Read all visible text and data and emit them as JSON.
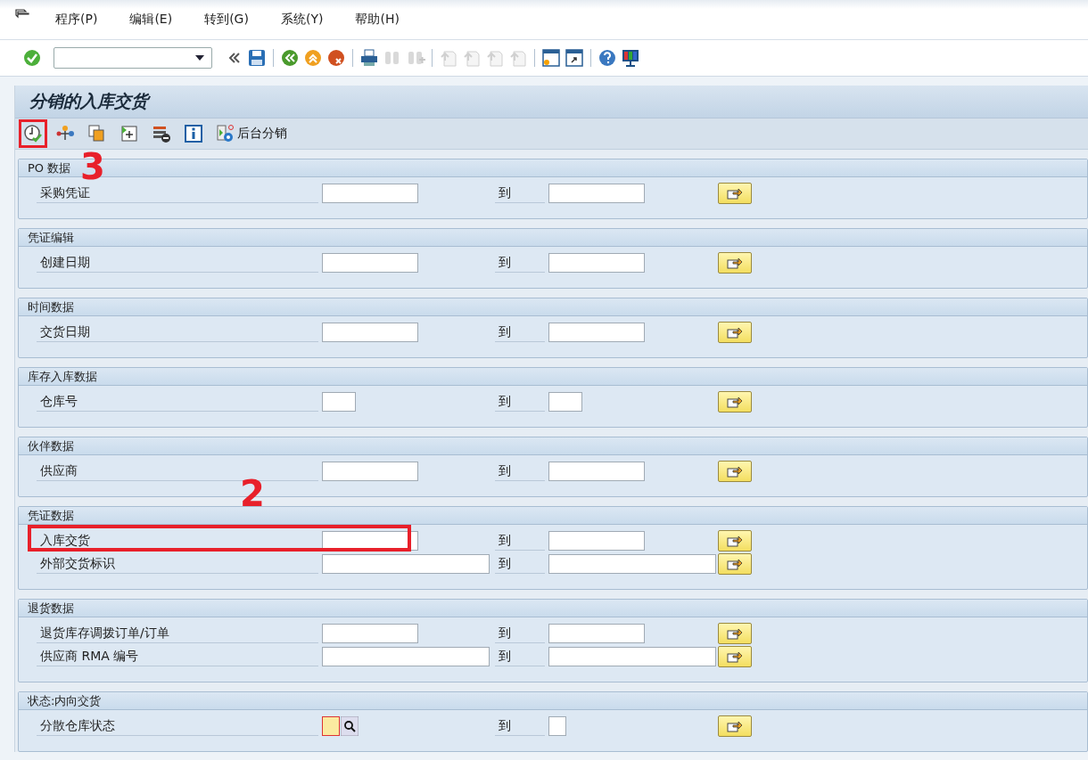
{
  "menu": [
    {
      "label": "程序(P)"
    },
    {
      "label": "编辑(E)"
    },
    {
      "label": "转到(G)"
    },
    {
      "label": "系统(Y)"
    },
    {
      "label": "帮助(H)"
    }
  ],
  "toolbar": [
    {
      "kind": "enter",
      "disabled": false
    },
    {
      "kind": "command"
    },
    {
      "kind": "collapse",
      "disabled": false
    },
    {
      "kind": "save",
      "disabled": false
    },
    {
      "kind": "sep"
    },
    {
      "kind": "back",
      "disabled": false
    },
    {
      "kind": "exit",
      "disabled": false
    },
    {
      "kind": "cancel",
      "disabled": false
    },
    {
      "kind": "sep"
    },
    {
      "kind": "print",
      "disabled": false
    },
    {
      "kind": "find",
      "disabled": true
    },
    {
      "kind": "findnext",
      "disabled": true
    },
    {
      "kind": "sep"
    },
    {
      "kind": "first",
      "disabled": true
    },
    {
      "kind": "prev",
      "disabled": true
    },
    {
      "kind": "next",
      "disabled": true
    },
    {
      "kind": "last",
      "disabled": true
    },
    {
      "kind": "sep"
    },
    {
      "kind": "newsession",
      "disabled": false
    },
    {
      "kind": "shortcut",
      "disabled": false
    },
    {
      "kind": "sep"
    },
    {
      "kind": "help",
      "disabled": false
    },
    {
      "kind": "layout",
      "disabled": false
    }
  ],
  "title": "分销的入库交货",
  "app_toolbar": [
    {
      "kind": "execute",
      "highlighted": true,
      "annotation": "3"
    },
    {
      "kind": "variant",
      "highlighted": false
    },
    {
      "kind": "copy",
      "highlighted": false
    },
    {
      "kind": "addsel",
      "highlighted": false
    },
    {
      "kind": "delsel",
      "highlighted": false
    },
    {
      "kind": "info",
      "highlighted": false
    },
    {
      "kind": "background",
      "highlighted": false,
      "label": "后台分销"
    }
  ],
  "groups": [
    {
      "title": "PO 数据",
      "rows": [
        {
          "label": "采购凭证",
          "kind": "medium",
          "to": "到",
          "highlighted": false
        }
      ]
    },
    {
      "title": "凭证编辑",
      "rows": [
        {
          "label": "创建日期",
          "kind": "medium",
          "to": "到",
          "highlighted": false
        }
      ]
    },
    {
      "title": "时间数据",
      "rows": [
        {
          "label": "交货日期",
          "kind": "medium",
          "to": "到",
          "highlighted": false
        }
      ]
    },
    {
      "title": "库存入库数据",
      "rows": [
        {
          "label": "仓库号",
          "kind": "small",
          "to": "到",
          "highlighted": false
        }
      ]
    },
    {
      "title": "伙伴数据",
      "rows": [
        {
          "label": "供应商",
          "kind": "medium",
          "to": "到",
          "highlighted": false
        }
      ]
    },
    {
      "title": "凭证数据",
      "rows": [
        {
          "label": "入库交货",
          "kind": "medium",
          "to": "到",
          "highlighted": true,
          "annotation": "2"
        },
        {
          "label": "外部交货标识",
          "kind": "long",
          "to": "到",
          "highlighted": false
        }
      ]
    },
    {
      "title": "退货数据",
      "rows": [
        {
          "label": "退货库存调拨订单/订单",
          "kind": "medium",
          "to": "到",
          "highlighted": false
        },
        {
          "label": "供应商 RMA 编号",
          "kind": "long",
          "to": "到",
          "highlighted": false
        }
      ]
    },
    {
      "title": "状态:内向交货",
      "rows": [
        {
          "label": "分散仓库状态",
          "kind": "required",
          "to": "到",
          "highlighted": false
        }
      ]
    }
  ]
}
